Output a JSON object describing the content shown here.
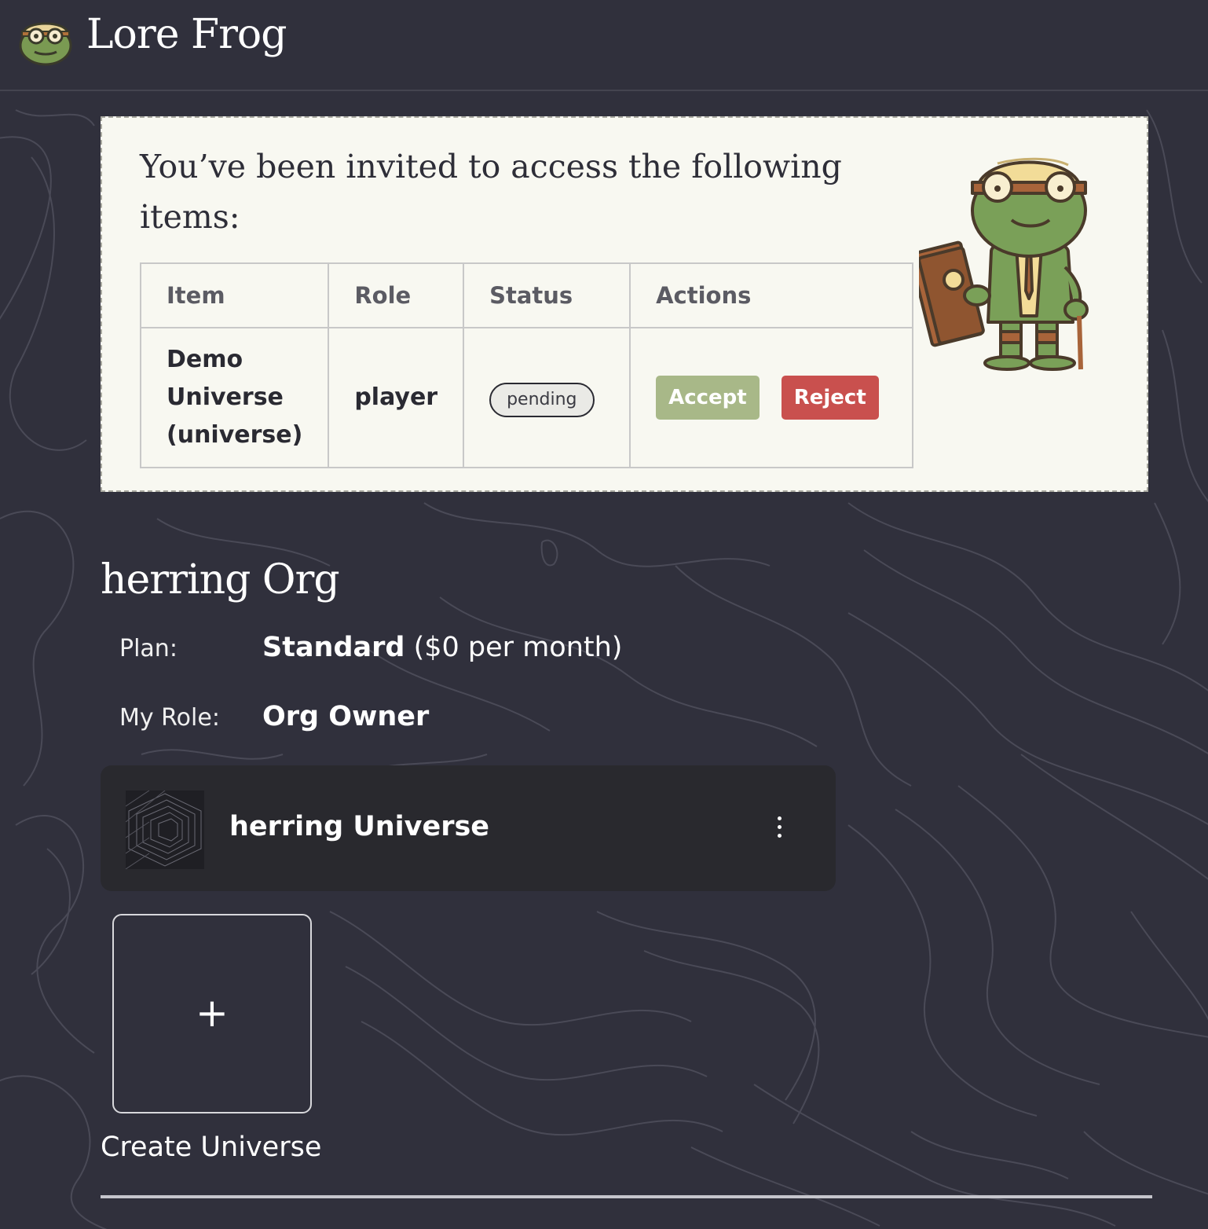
{
  "header": {
    "brand": "Lore Frog",
    "logo_icon": "frog-logo-icon"
  },
  "invite": {
    "title": "You’ve been invited to access the following items:",
    "columns": [
      "Item",
      "Role",
      "Status",
      "Actions"
    ],
    "rows": [
      {
        "item": "Demo Universe (universe)",
        "role": "player",
        "status": "pending",
        "accept_label": "Accept",
        "reject_label": "Reject"
      }
    ],
    "illustration_icon": "frog-scholar-illustration",
    "colors": {
      "accept": "#a8b888",
      "reject": "#c9504e",
      "panel_bg": "#f8f8f1"
    }
  },
  "org": {
    "title": "herring Org",
    "plan_label": "Plan:",
    "plan_name": "Standard",
    "plan_price": "($0 per month)",
    "role_label": "My Role:",
    "role_value": "Org Owner"
  },
  "universes": [
    {
      "name": "herring Universe",
      "menu_icon": "kebab-menu-icon"
    }
  ],
  "create": {
    "icon": "+",
    "label": "Create Universe"
  },
  "colors": {
    "page_bg": "#30303c",
    "card_bg": "#29292e"
  }
}
